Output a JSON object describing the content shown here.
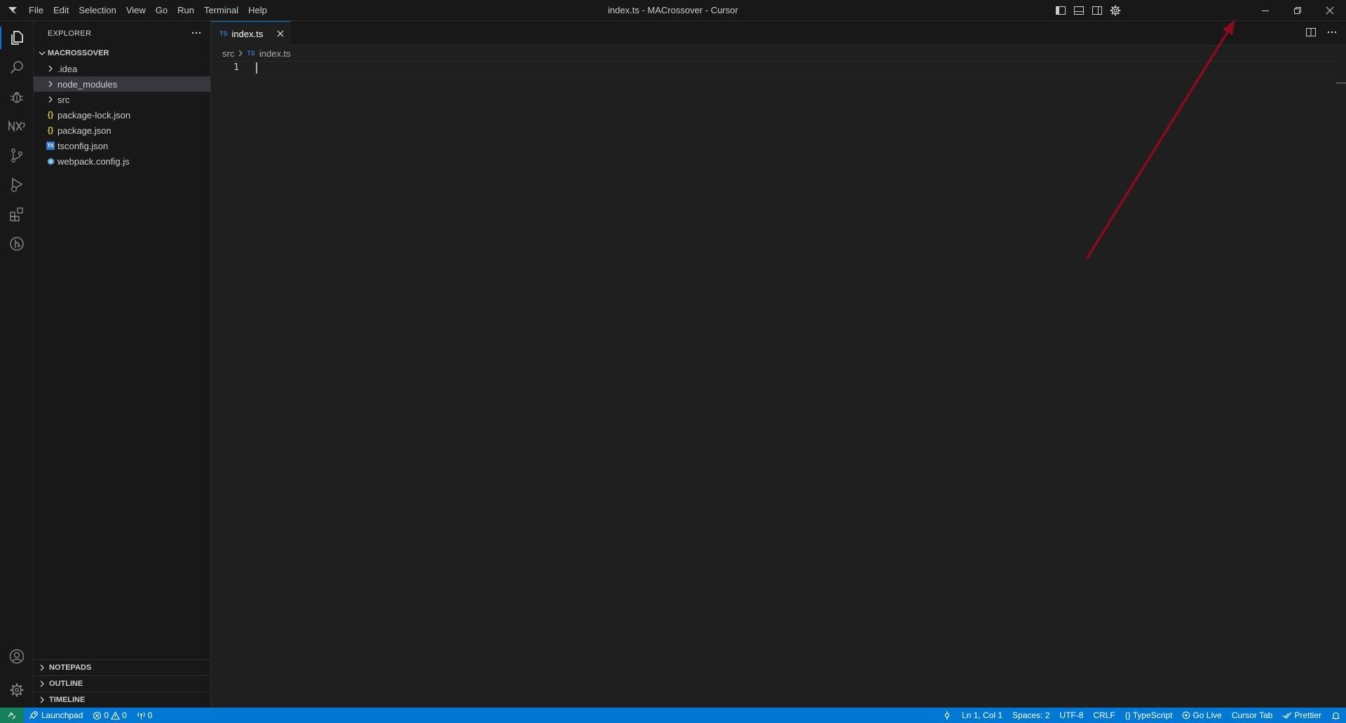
{
  "window": {
    "title": "index.ts - MACrossover - Cursor",
    "menu": [
      "File",
      "Edit",
      "Selection",
      "View",
      "Go",
      "Run",
      "Terminal",
      "Help"
    ],
    "title_actions": [
      "toggle-primary-sidebar-icon",
      "toggle-panel-icon",
      "toggle-secondary-sidebar-icon",
      "gear-icon"
    ],
    "controls": [
      "minimize-icon",
      "restore-icon",
      "close-icon"
    ]
  },
  "activity_bar": {
    "items": [
      "explorer-icon",
      "search-icon",
      "debug-icon",
      "nx-console-icon",
      "source-control-icon",
      "run-debug-icon",
      "extensions-icon",
      "git-graph-icon"
    ],
    "bottom": [
      "account-icon",
      "manage-gear-icon"
    ]
  },
  "sidebar": {
    "title": "EXPLORER",
    "folder": "MACROSSOVER",
    "tree": [
      {
        "label": ".idea",
        "type": "folder"
      },
      {
        "label": "node_modules",
        "type": "folder",
        "selected": true
      },
      {
        "label": "src",
        "type": "folder"
      },
      {
        "label": "package-lock.json",
        "type": "json",
        "icon": "{}"
      },
      {
        "label": "package.json",
        "type": "json",
        "icon": "{}"
      },
      {
        "label": "tsconfig.json",
        "type": "tsconfig",
        "icon": "TS"
      },
      {
        "label": "webpack.config.js",
        "type": "webpack"
      }
    ],
    "panels": [
      "NOTEPADS",
      "OUTLINE",
      "TIMELINE"
    ]
  },
  "editor": {
    "tab": {
      "badge": "TS",
      "label": "index.ts"
    },
    "breadcrumb": {
      "folder": "src",
      "badge": "TS",
      "file": "index.ts"
    },
    "lines": [
      "1"
    ]
  },
  "status_bar": {
    "launchpad": "Launchpad",
    "errors": "0",
    "warnings": "0",
    "ports": "0",
    "position": "Ln 1, Col 1",
    "spaces": "Spaces: 2",
    "encoding": "UTF-8",
    "eol": "CRLF",
    "language": "TypeScript",
    "go_live": "Go Live",
    "cursor_tab": "Cursor Tab",
    "prettier": "Prettier"
  },
  "annotation": {
    "color": "#8b0a1e"
  },
  "colors": {
    "accent": "#0078d4",
    "remote": "#16825d",
    "background": "#1f1f1f",
    "sidebar": "#181818"
  }
}
